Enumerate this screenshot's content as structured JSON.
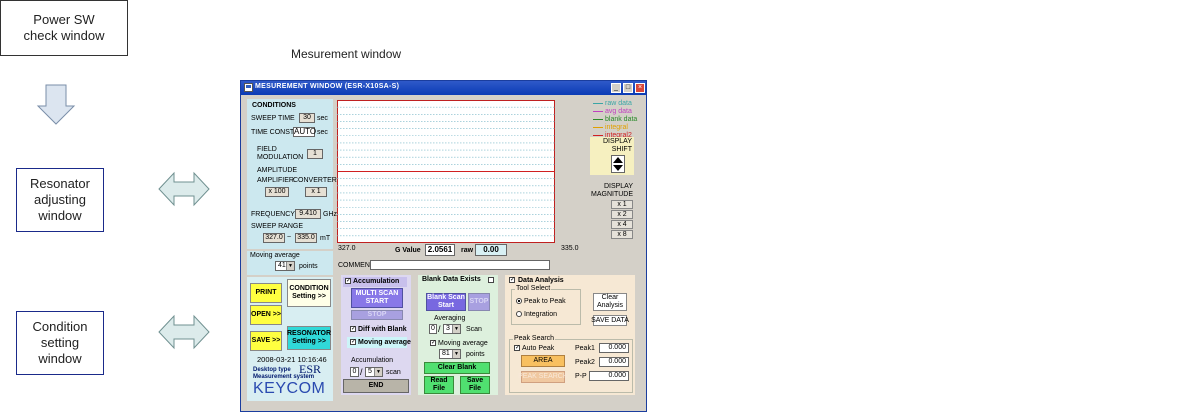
{
  "diagram": {
    "power_sw": "Power SW\ncheck window",
    "resonator": "Resonator\nadjusting\nwindow",
    "condition": "Condition\nsetting\nwindow",
    "caption": "Mesurement window"
  },
  "window": {
    "title": "MESUREMENT WINDOW (ESR-X10SA-S)",
    "conditions": {
      "header": "CONDITIONS",
      "sweep_time_label": "SWEEP TIME",
      "sweep_time_value": "30",
      "sweep_time_unit": "sec",
      "time_const_label": "TIME CONST.",
      "time_const_value": "AUTO",
      "time_const_unit": "sec",
      "field_mod_label1": "FIELD",
      "field_mod_label2": "MODULATION",
      "field_mod_value": "1",
      "amplitude_label": "AMPLITUDE",
      "amplifier_label": "AMPLIFIER",
      "converter_label": "CONVERTER",
      "amplifier_value": "x 100",
      "converter_value": "x 1",
      "frequency_label": "FREQUENCY",
      "frequency_value": "9.410",
      "frequency_unit": "GHz",
      "sweep_range_label": "SWEEP RANGE",
      "sweep_from": "327.0",
      "sweep_sep": "~",
      "sweep_to": "335.0",
      "sweep_unit": "mT",
      "moving_avg_label": "Moving average",
      "moving_avg_value": "41",
      "moving_avg_unit": "points"
    },
    "chart": {
      "x_min_label": "327.0",
      "x_max_label": "335.0",
      "g_value_label": "G Value",
      "g_value": "2.0561",
      "raw_label": "raw",
      "raw_value": "0.00",
      "comment_label": "COMMENT:"
    },
    "legend": {
      "items": [
        {
          "label": "raw data",
          "color": "#3aa6a6"
        },
        {
          "label": "avg data",
          "color": "#c040c0"
        },
        {
          "label": "blank data",
          "color": "#2a8a2a"
        },
        {
          "label": "integral",
          "color": "#e0a000"
        },
        {
          "label": "integral2",
          "color": "#d02020"
        }
      ],
      "display_shift": "DISPLAY\nSHIFT",
      "display_magnitude": "DISPLAY\nMAGNITUDE",
      "magnitudes": [
        "x 1",
        "x 2",
        "x 4",
        "x 8"
      ]
    },
    "left_buttons": {
      "print": "PRINT",
      "condition": "CONDITION\nSetting >>",
      "open": "OPEN >>",
      "save": "SAVE >>",
      "resonator": "RESONATOR\nSetting >>",
      "timestamp": "2008-03-21 10:16:46",
      "brand_line1": "Desktop type",
      "brand_esr": "ESR",
      "brand_line2": "Measurement system",
      "brand_logo": "KEYCOM"
    },
    "accumulation": {
      "header": "Accumulation",
      "multi_scan": "MULTI SCAN\nSTART",
      "stop": "STOP",
      "diff_blank": "Diff with Blank",
      "moving_average": "Moving average",
      "accum_label": "Accumulation",
      "accum_current": "0",
      "accum_slash": "/",
      "accum_total": "5",
      "accum_unit": "scan",
      "end": "END"
    },
    "blank": {
      "header": "Blank Data Exists",
      "scan_start": "Blank Scan\nStart",
      "stop": "STOP",
      "averaging_label": "Averaging",
      "avg_current": "0",
      "avg_slash": "/",
      "avg_total": "3",
      "avg_unit": "Scan",
      "moving_avg_label": "Moving average",
      "moving_avg_value": "81",
      "moving_avg_unit": "points",
      "clear_blank": "Clear Blank",
      "read_file": "Read\nFile",
      "save_file": "Save\nFile"
    },
    "analysis": {
      "header": "Data Analysis",
      "tool_select": "Tool Select",
      "peak_to_peak": "Peak to Peak",
      "integration": "Integration",
      "clear_analysis": "Clear\nAnalysis",
      "save_data": "SAVE DATA",
      "peak_search": "Peak Search",
      "auto_peak": "Auto Peak",
      "area": "AREA",
      "peak_search_btn": "PEAK SEARCH",
      "peak1_label": "Peak1",
      "peak1_value": "0.000",
      "peak2_label": "Peak2",
      "peak2_value": "0.000",
      "pp_label": "P-P",
      "pp_value": "0.000"
    }
  }
}
